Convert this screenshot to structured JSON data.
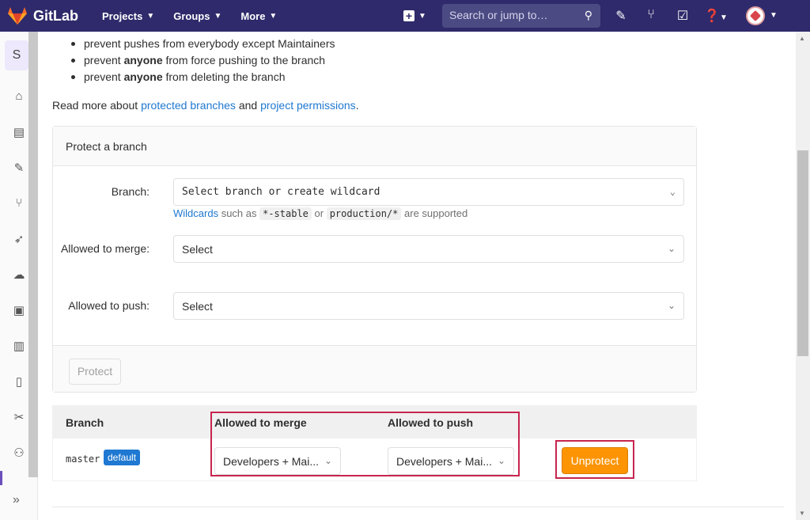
{
  "nav": {
    "brand": "GitLab",
    "projects": "Projects",
    "groups": "Groups",
    "more": "More",
    "search_placeholder": "Search or jump to…"
  },
  "sidebar": {
    "project_initial": "S"
  },
  "rules": [
    "prevent pushes from everybody except Maintainers",
    "prevent ",
    "anyone",
    " from force pushing to the branch",
    "prevent ",
    "anyone",
    " from deleting the branch"
  ],
  "readmore": {
    "prefix": "Read more about ",
    "link1": "protected branches",
    "middle": " and ",
    "link2": "project permissions",
    "suffix": "."
  },
  "form": {
    "title": "Protect a branch",
    "branch_label": "Branch:",
    "branch_placeholder": "Select branch or create wildcard",
    "hint_link": "Wildcards",
    "hint_text1": " such as ",
    "hint_code1": "*-stable",
    "hint_text2": " or ",
    "hint_code2": "production/*",
    "hint_text3": " are supported",
    "merge_label": "Allowed to merge:",
    "merge_value": "Select",
    "push_label": "Allowed to push:",
    "push_value": "Select",
    "protect_button": "Protect"
  },
  "table": {
    "headers": {
      "branch": "Branch",
      "merge": "Allowed to merge",
      "push": "Allowed to push"
    },
    "rows": [
      {
        "branch": "master",
        "badge": "default",
        "merge": "Developers + Mai...",
        "push": "Developers + Mai...",
        "action": "Unprotect"
      }
    ]
  },
  "colors": {
    "nav": "#2f2a6b",
    "link": "#1f78d1",
    "unprotect": "#fc9403",
    "highlight": "#c7254e"
  }
}
